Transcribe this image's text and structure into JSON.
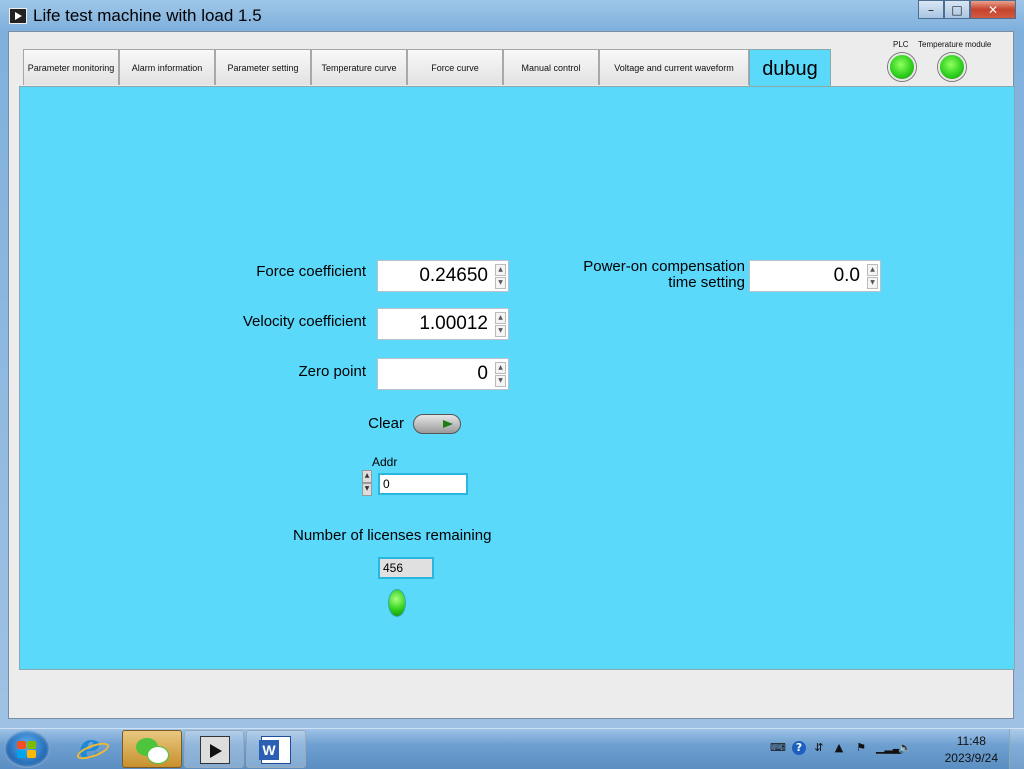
{
  "window": {
    "title": "Life test machine with load 1.5",
    "minimize": "–",
    "maximize": "□",
    "close": "✕"
  },
  "tabs": [
    {
      "label": "Parameter monitoring"
    },
    {
      "label": "Alarm information"
    },
    {
      "label": "Parameter setting"
    },
    {
      "label": "Temperature curve"
    },
    {
      "label": "Force curve"
    },
    {
      "label": "Manual control"
    },
    {
      "label": "Voltage and current waveform"
    },
    {
      "label": "dubug",
      "active": true
    }
  ],
  "indicators": {
    "plc_label": "PLC",
    "temp_label": "Temperature module"
  },
  "debug": {
    "force_coefficient_label": "Force coefficient",
    "force_coefficient_value": "0.24650",
    "velocity_coefficient_label": "Velocity coefficient",
    "velocity_coefficient_value": "1.00012",
    "zero_point_label": "Zero point",
    "zero_point_value": "0",
    "power_on_label_line1": "Power-on compensation",
    "power_on_label_line2": "time setting",
    "power_on_value": "0.0",
    "clear_label": "Clear",
    "addr_label": "Addr",
    "addr_value": "0",
    "licenses_label": "Number of licenses remaining",
    "licenses_value": "456"
  },
  "taskbar": {
    "time": "11:48",
    "date": "2023/9/24",
    "active_app": "wechat"
  },
  "colors": {
    "panel": "#5ad9fb",
    "led_on": "#2fd21e"
  }
}
